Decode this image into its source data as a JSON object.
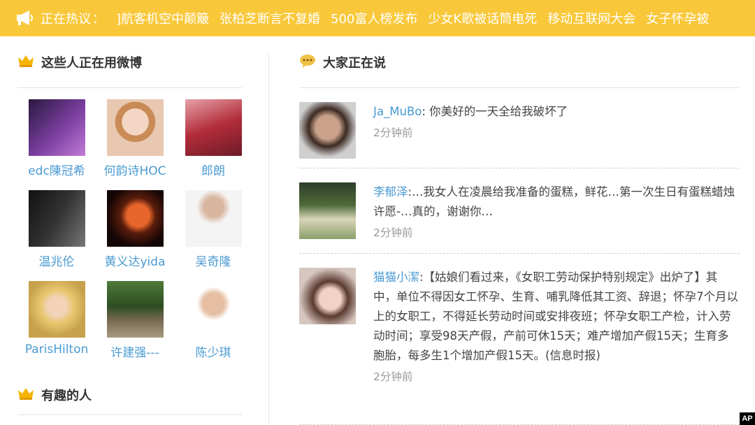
{
  "hot_bar": {
    "label": "正在热议",
    "colon": "：",
    "topics": [
      "]航客机空中颠簸",
      "张柏芝断言不复婚",
      "500富人榜发布",
      "少女K歌被话筒电死",
      "移动互联网大会",
      "女子怀孕被"
    ]
  },
  "left": {
    "section1_title": "这些人正在用微博",
    "users": [
      {
        "name": "edc陳冠希"
      },
      {
        "name": "何韵诗HOC"
      },
      {
        "name": "郎朗"
      },
      {
        "name": "温兆伦"
      },
      {
        "name": "黄义达yida"
      },
      {
        "name": "吴奇隆"
      },
      {
        "name": "ParisHilton"
      },
      {
        "name": "许建强---"
      },
      {
        "name": "陈少琪"
      }
    ],
    "section2_title": "有趣的人"
  },
  "right": {
    "section_title": "大家正在说",
    "posts": [
      {
        "author": "Ja_MuBo",
        "text": ": 你美好的一天全给我破坏了",
        "time": "2分钟前"
      },
      {
        "author": "李郁泽",
        "text": ":…我女人在凌晨给我准备的蛋糕，鲜花…第一次生日有蛋糕蜡烛许愿-…真的，谢谢你…",
        "time": "2分钟前"
      },
      {
        "author": "猫猫小潔",
        "text": ":【姑娘们看过来，《女职工劳动保护特别规定》出炉了】其中，单位不得因女工怀孕、生育、哺乳降低其工资、辞退；怀孕7个月以上的女职工，不得延长劳动时间或安排夜班；怀孕女职工产检，计入劳动时间；享受98天产假，产前可休15天；难产增加产假15天；生育多胞胎，每多生1个增加产假15天。(信息时报)",
        "time": "2分钟前"
      }
    ]
  },
  "watermark": "AP",
  "colors": {
    "hot_bar_bg": "#f9c83a",
    "link": "#4a9ad2",
    "meta": "#999999"
  }
}
